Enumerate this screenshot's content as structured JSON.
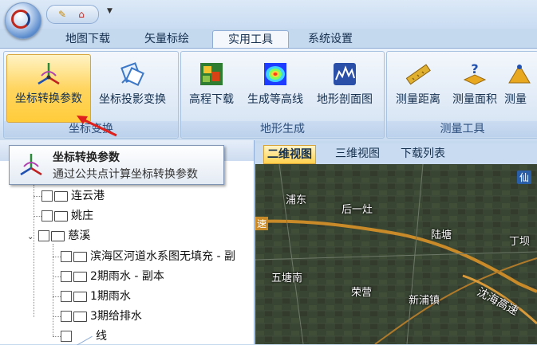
{
  "ribbon": {
    "tabs": [
      "地图下载",
      "矢量标绘",
      "实用工具",
      "系统设置"
    ],
    "active_tab": "实用工具",
    "groups": [
      {
        "label": "坐标变换",
        "buttons": [
          "坐标转换参数",
          "坐标投影变换"
        ]
      },
      {
        "label": "地形生成",
        "buttons": [
          "高程下载",
          "生成等高线",
          "地形剖面图"
        ]
      },
      {
        "label": "测量工具",
        "buttons": [
          "测量距离",
          "测量面积",
          "测量"
        ]
      }
    ]
  },
  "tooltip": {
    "title": "坐标转换参数",
    "description": "通过公共点计算坐标转换参数"
  },
  "tree": {
    "items": [
      "连云港",
      "姚庄",
      "慈溪",
      "滨海区河道水系图无填充 - 副",
      "2期雨水 - 副本",
      "1期雨水",
      "3期给排水",
      "线"
    ]
  },
  "map": {
    "tabs": [
      "二维视图",
      "三维视图",
      "下载列表"
    ],
    "active_tab": "二维视图",
    "place_labels": [
      "浦东",
      "后一灶",
      "速",
      "陆塘",
      "丁坝",
      "五塘南",
      "荣营",
      "新浦镇",
      "沈海高速",
      "仙"
    ]
  },
  "colors": {
    "ribbon_bg": "#dfeaf7",
    "highlight": "#ffd560",
    "highway": "#c98a2a"
  }
}
